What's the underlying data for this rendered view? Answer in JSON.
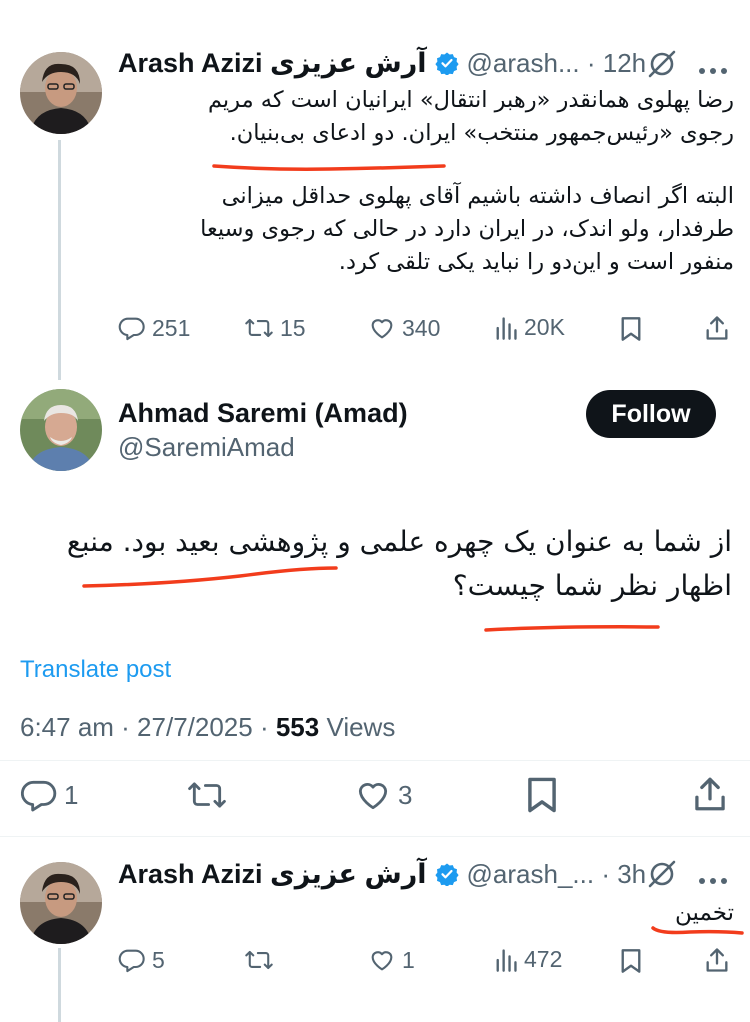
{
  "tweet1": {
    "name": "Arash Azizi آرش عزیزی",
    "handle_time": "@arash... · 12h",
    "text_line1": "رضا پهلوی همانقدر «رهبر انتقال» ایرانیان است که مریم",
    "text_line2": "رجوی «رئیس‌جمهور منتخب» ایران. دو ادعای بی‌بنیان.",
    "text_line3": "البته اگر انصاف داشته باشیم آقای پهلوی حداقل میزانی",
    "text_line4": "طرفدار، ولو اندک، در ایران دارد در حالی که رجوی وسیعا",
    "text_line5": "منفور است و این‌دو را نباید یکی تلقی کرد.",
    "replies": "251",
    "retweets": "15",
    "likes": "340",
    "views": "20K"
  },
  "main": {
    "name": "Ahmad Saremi (Amad)",
    "handle": "@SaremiAmad",
    "follow_label": "Follow",
    "text_line1": "از شما به عنوان یک چهره علمی و پژوهشی بعید بود. منبع",
    "text_line2": "اظهار نظر شما چیست؟",
    "translate_label": "Translate post",
    "timestamp": "6:47 am · 27/7/2025 · ",
    "views_count": "553",
    "views_label": " Views",
    "replies": "1",
    "likes": "3"
  },
  "tweet3": {
    "name": "Arash Azizi آرش عزیزی",
    "handle_time": "@arash_... · 3h",
    "text": "تخمین",
    "replies": "5",
    "likes": "1",
    "views": "472"
  },
  "colors": {
    "accent": "#1d9bf0",
    "annotation": "#f23c1c",
    "muted": "#536471"
  },
  "icons": [
    "grok-icon",
    "more-icon",
    "verified-icon",
    "reply-icon",
    "retweet-icon",
    "like-icon",
    "views-icon",
    "bookmark-icon",
    "share-icon"
  ]
}
